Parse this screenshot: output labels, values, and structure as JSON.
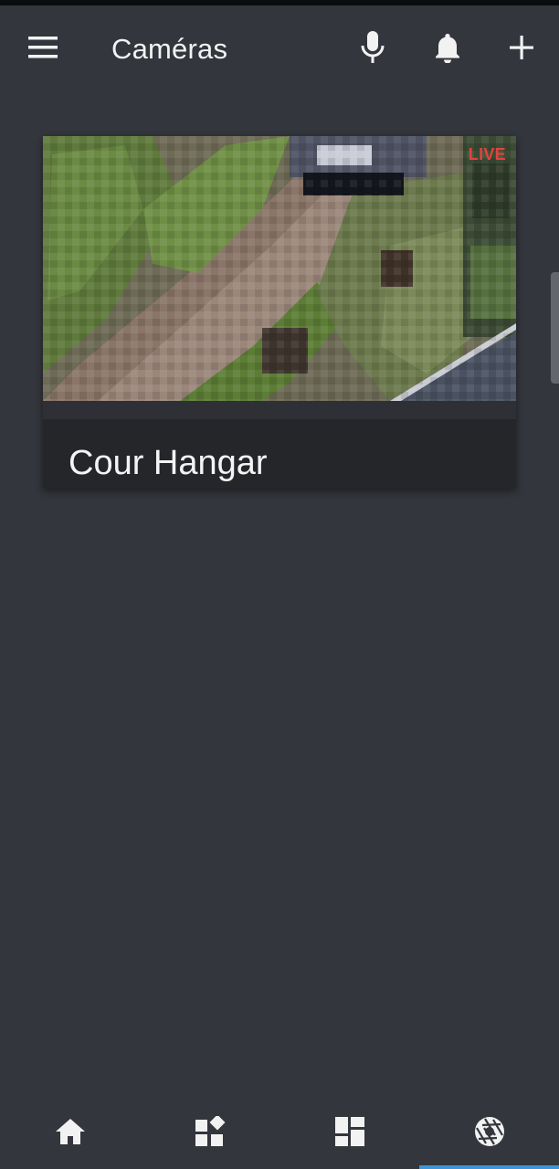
{
  "app_bar": {
    "title": "Caméras",
    "menu_icon": "menu-icon",
    "actions": [
      {
        "name": "mic-icon"
      },
      {
        "name": "bell-icon"
      },
      {
        "name": "plus-icon"
      }
    ]
  },
  "camera": {
    "name": "Cour Hangar",
    "live_label": "LIVE",
    "live_color": "#e0443e"
  },
  "bottom_nav": {
    "items": [
      {
        "name": "home-icon"
      },
      {
        "name": "widgets-icon"
      },
      {
        "name": "dashboard-icon"
      },
      {
        "name": "camera-aperture-icon",
        "selected": true
      }
    ],
    "accent": "#3e95d8"
  },
  "colors": {
    "background": "#33363c",
    "card": "#24262a",
    "text": "#f2f2f2"
  }
}
